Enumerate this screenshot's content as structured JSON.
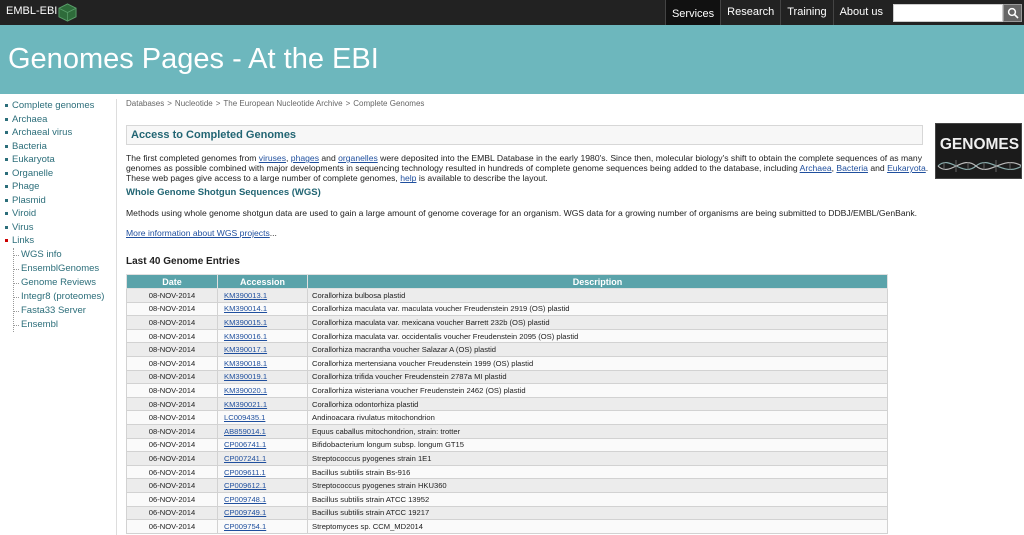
{
  "topbar": {
    "brand": "EMBL-EBI",
    "nav": [
      "Services",
      "Research",
      "Training",
      "About us"
    ],
    "active_nav": "Services",
    "search_placeholder": ""
  },
  "banner": {
    "title": "Genomes Pages - At the EBI"
  },
  "sidebar": {
    "items": [
      "Complete genomes",
      "Archaea",
      "Archaeal virus",
      "Bacteria",
      "Eukaryota",
      "Organelle",
      "Phage",
      "Plasmid",
      "Viroid",
      "Virus"
    ],
    "links_label": "Links",
    "sub_items": [
      "WGS info",
      "EnsemblGenomes",
      "Genome Reviews",
      "Integr8 (proteomes)",
      "Fasta33 Server",
      "Ensembl"
    ]
  },
  "breadcrumb": [
    "Databases",
    "Nucleotide",
    "The European Nucleotide Archive",
    "Complete Genomes"
  ],
  "access": {
    "title": "Access to Completed Genomes",
    "image_label": "GENOMES",
    "intro": {
      "t1": "The first completed genomes from ",
      "viruses": "viruses",
      "t2": ", ",
      "phages": "phages",
      "t3": " and ",
      "organelles": "organelles",
      "t4": " were deposited into the EMBL Database in the early 1980's. Since then, molecular biology's shift to obtain the complete sequences of as many genomes as possible combined with major developments in sequencing technology resulted in hundreds of complete genome sequences being added to the database, including ",
      "archaea": "Archaea",
      "t5": ", ",
      "bacteria": "Bacteria",
      "t6": " and ",
      "eukaryota": "Eukaryota",
      "t7": ". These web pages give access to a large number of complete genomes, ",
      "help": "help",
      "t8": " is available to describe the layout."
    },
    "wgs_heading": "Whole Genome Shotgun Sequences (WGS)",
    "wgs_text": "Methods using whole genome shotgun data are used to gain a large amount of genome coverage for an organism. WGS data for a growing number of organisms are being submitted to DDBJ/EMBL/GenBank.",
    "more_info_link": "More information about WGS projects",
    "more_info_suffix": "..."
  },
  "last40": {
    "heading": "Last 40 Genome Entries",
    "columns": [
      "Date",
      "Accession",
      "Description"
    ],
    "rows": [
      [
        "08-NOV-2014",
        "KM390013.1",
        "Corallorhiza bulbosa plastid"
      ],
      [
        "08-NOV-2014",
        "KM390014.1",
        "Corallorhiza maculata var. maculata voucher Freudenstein 2919 (OS) plastid"
      ],
      [
        "08-NOV-2014",
        "KM390015.1",
        "Corallorhiza maculata var. mexicana voucher Barrett 232b (OS) plastid"
      ],
      [
        "08-NOV-2014",
        "KM390016.1",
        "Corallorhiza maculata var. occidentalis voucher Freudenstein 2095 (OS) plastid"
      ],
      [
        "08-NOV-2014",
        "KM390017.1",
        "Corallorhiza macrantha voucher Salazar A (OS) plastid"
      ],
      [
        "08-NOV-2014",
        "KM390018.1",
        "Corallorhiza mertensiana voucher Freudenstein 1999 (OS) plastid"
      ],
      [
        "08-NOV-2014",
        "KM390019.1",
        "Corallorhiza trifida voucher Freudenstein 2787a MI plastid"
      ],
      [
        "08-NOV-2014",
        "KM390020.1",
        "Corallorhiza wisteriana voucher Freudenstein 2462 (OS) plastid"
      ],
      [
        "08-NOV-2014",
        "KM390021.1",
        "Corallorhiza odontorhiza plastid"
      ],
      [
        "08-NOV-2014",
        "LC009435.1",
        "Andinoacara rivulatus mitochondrion"
      ],
      [
        "08-NOV-2014",
        "AB859014.1",
        "Equus caballus mitochondrion, strain: trotter"
      ],
      [
        "06-NOV-2014",
        "CP006741.1",
        "Bifidobacterium longum subsp. longum GT15"
      ],
      [
        "06-NOV-2014",
        "CP007241.1",
        "Streptococcus pyogenes strain 1E1"
      ],
      [
        "06-NOV-2014",
        "CP009611.1",
        "Bacillus subtilis strain Bs-916"
      ],
      [
        "06-NOV-2014",
        "CP009612.1",
        "Streptococcus pyogenes strain HKU360"
      ],
      [
        "06-NOV-2014",
        "CP009748.1",
        "Bacillus subtilis strain ATCC 13952"
      ],
      [
        "06-NOV-2014",
        "CP009749.1",
        "Bacillus subtilis strain ATCC 19217"
      ],
      [
        "06-NOV-2014",
        "CP009754.1",
        "Streptomyces sp. CCM_MD2014"
      ]
    ]
  }
}
